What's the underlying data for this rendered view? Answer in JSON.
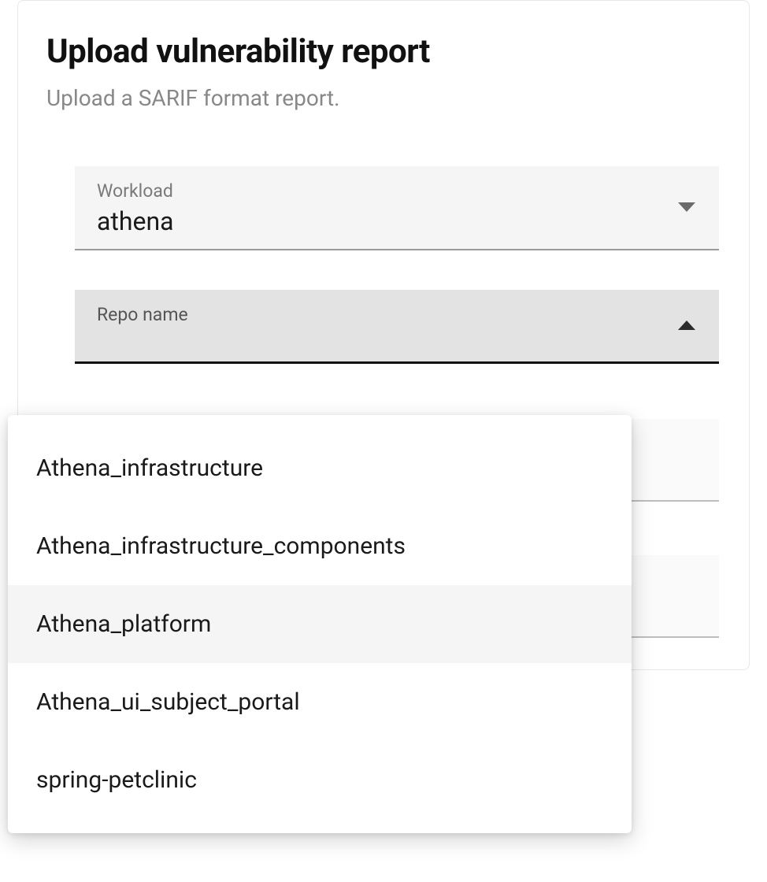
{
  "header": {
    "title": "Upload vulnerability report",
    "subtitle": "Upload a SARIF format report."
  },
  "fields": {
    "workload": {
      "label": "Workload",
      "value": "athena"
    },
    "repo": {
      "label": "Repo name",
      "options": [
        "Athena_infrastructure",
        "Athena_infrastructure_components",
        "Athena_platform",
        "Athena_ui_subject_portal",
        "spring-petclinic"
      ],
      "hovered_index": 2
    }
  }
}
